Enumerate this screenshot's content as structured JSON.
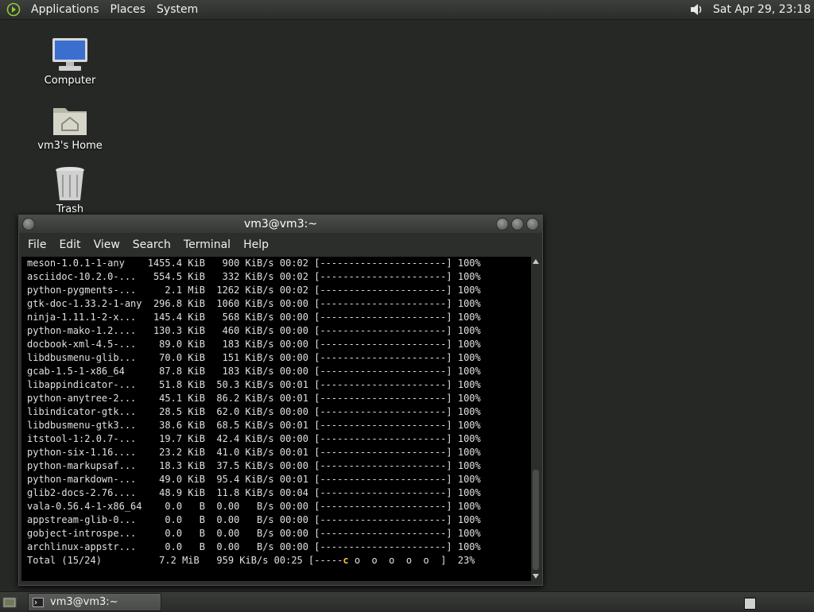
{
  "top_panel": {
    "menus": [
      "Applications",
      "Places",
      "System"
    ],
    "clock": "Sat Apr 29, 23:18",
    "menu_logo_icon": "distro-logo-icon",
    "volume_icon": "speaker-icon"
  },
  "desktop_icons": [
    {
      "label": "Computer",
      "icon": "computer-icon"
    },
    {
      "label": "vm3's Home",
      "icon": "home-folder-icon"
    },
    {
      "label": "Trash",
      "icon": "trash-icon"
    }
  ],
  "window": {
    "title": "vm3@vm3:~",
    "menu": [
      "File",
      "Edit",
      "View",
      "Search",
      "Terminal",
      "Help"
    ]
  },
  "terminal": {
    "lines": [
      "meson-1.0.1-1-any    1455.4 KiB   900 KiB/s 00:02 [----------------------] 100%",
      "asciidoc-10.2.0-...   554.5 KiB   332 KiB/s 00:02 [----------------------] 100%",
      "python-pygments-...     2.1 MiB  1262 KiB/s 00:02 [----------------------] 100%",
      "gtk-doc-1.33.2-1-any  296.8 KiB  1060 KiB/s 00:00 [----------------------] 100%",
      "ninja-1.11.1-2-x...   145.4 KiB   568 KiB/s 00:00 [----------------------] 100%",
      "python-mako-1.2....   130.3 KiB   460 KiB/s 00:00 [----------------------] 100%",
      "docbook-xml-4.5-...    89.0 KiB   183 KiB/s 00:00 [----------------------] 100%",
      "libdbusmenu-glib...    70.0 KiB   151 KiB/s 00:00 [----------------------] 100%",
      "gcab-1.5-1-x86_64      87.8 KiB   183 KiB/s 00:00 [----------------------] 100%",
      "libappindicator-...    51.8 KiB  50.3 KiB/s 00:01 [----------------------] 100%",
      "python-anytree-2...    45.1 KiB  86.2 KiB/s 00:01 [----------------------] 100%",
      "libindicator-gtk...    28.5 KiB  62.0 KiB/s 00:00 [----------------------] 100%",
      "libdbusmenu-gtk3...    38.6 KiB  68.5 KiB/s 00:01 [----------------------] 100%",
      "itstool-1:2.0.7-...    19.7 KiB  42.4 KiB/s 00:00 [----------------------] 100%",
      "python-six-1.16....    23.2 KiB  41.0 KiB/s 00:01 [----------------------] 100%",
      "python-markupsaf...    18.3 KiB  37.5 KiB/s 00:00 [----------------------] 100%",
      "python-markdown-...    49.0 KiB  95.4 KiB/s 00:01 [----------------------] 100%",
      "glib2-docs-2.76....    48.9 KiB  11.8 KiB/s 00:04 [----------------------] 100%",
      "vala-0.56.4-1-x86_64    0.0   B  0.00   B/s 00:00 [----------------------] 100%",
      "appstream-glib-0...     0.0   B  0.00   B/s 00:00 [----------------------] 100%",
      "gobject-introspe...     0.0   B  0.00   B/s 00:00 [----------------------] 100%",
      "archlinux-appstr...     0.0   B  0.00   B/s 00:00 [----------------------] 100%"
    ],
    "total_prefix": "Total (15/24)          7.2 MiB   959 KiB/s 00:25 [-----",
    "total_cursor": "c",
    "total_suffix": " o  o  o  o  o  ]  23%"
  },
  "taskbar": {
    "window_button": "vm3@vm3:~"
  }
}
